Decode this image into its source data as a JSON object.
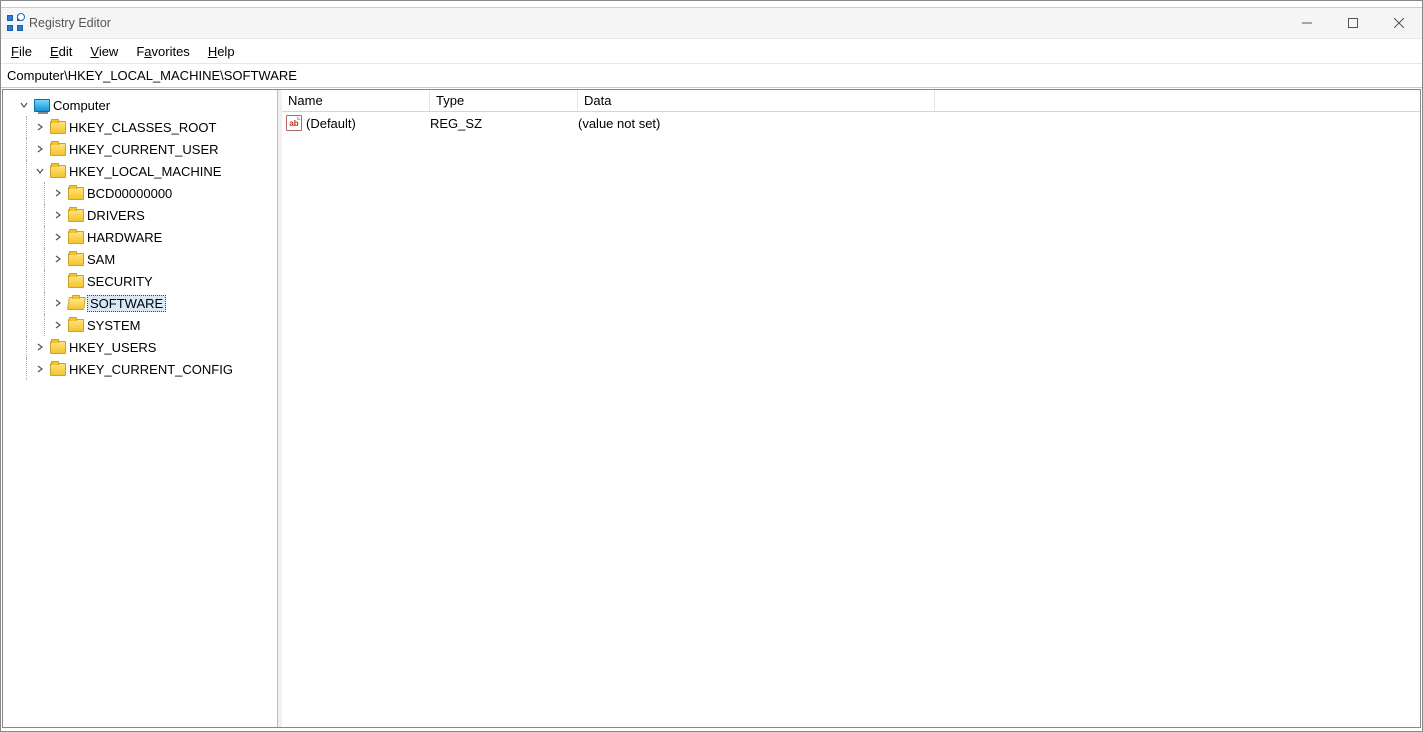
{
  "window": {
    "title": "Registry Editor"
  },
  "menu": {
    "file": "File",
    "edit": "Edit",
    "view": "View",
    "favorites": "Favorites",
    "help": "Help"
  },
  "address": "Computer\\HKEY_LOCAL_MACHINE\\SOFTWARE",
  "tree": {
    "root": "Computer",
    "hkcr": "HKEY_CLASSES_ROOT",
    "hkcu": "HKEY_CURRENT_USER",
    "hklm": "HKEY_LOCAL_MACHINE",
    "hklm_children": {
      "bcd": "BCD00000000",
      "drivers": "DRIVERS",
      "hardware": "HARDWARE",
      "sam": "SAM",
      "security": "SECURITY",
      "software": "SOFTWARE",
      "system": "SYSTEM"
    },
    "hku": "HKEY_USERS",
    "hkcc": "HKEY_CURRENT_CONFIG"
  },
  "columns": {
    "name": "Name",
    "type": "Type",
    "data": "Data"
  },
  "values": [
    {
      "name": "(Default)",
      "type": "REG_SZ",
      "data": "(value not set)"
    }
  ]
}
